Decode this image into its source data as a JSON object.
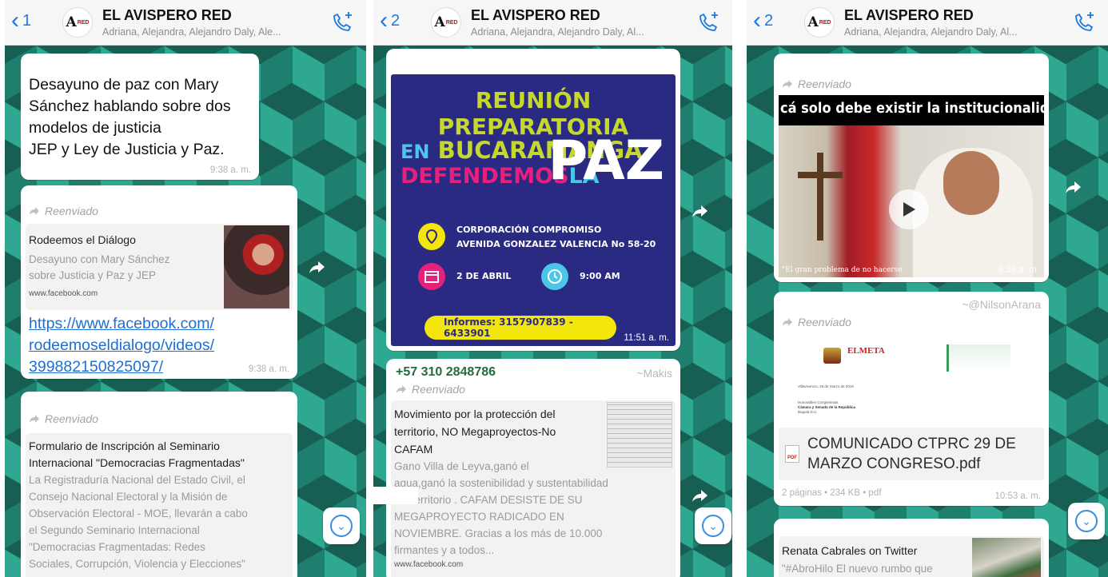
{
  "header": {
    "title": "EL AVISPERO RED",
    "subtitle_1": "Adriana, Alejandra, Alejandro Daly, Ale...",
    "subtitle_2": "Adriana, Alejandra, Alejandro Daly, Al...",
    "avatar_letter": "A",
    "avatar_small": "RED",
    "back_1": "1",
    "back_2": "2",
    "back_3": "2"
  },
  "panel1": {
    "msg1": {
      "lines": [
        "Desayuno de paz con Mary",
        "Sánchez hablando sobre dos",
        "modelos de justicia",
        "JEP y Ley de Justicia y Paz."
      ],
      "time": "9:38 a. m."
    },
    "msg2": {
      "forwarded": "Reenviado",
      "preview_title": "Rodeemos el Diálogo",
      "preview_desc_1": "Desayuno con Mary Sánchez",
      "preview_desc_2": "sobre Justicia y Paz y JEP",
      "preview_url": "www.facebook.com",
      "link_1": "https://www.facebook.com/",
      "link_2": "rodeemoseldialogo/videos/",
      "link_3": "399882150825097/",
      "time": "9:38 a. m."
    },
    "msg3": {
      "forwarded": "Reenviado",
      "title_1": "Formulario de Inscripción al Seminario",
      "title_2": "Internacional \"Democracias Fragmentadas\"",
      "desc": [
        "La Registraduría Nacional del Estado Civil, el",
        "Consejo Nacional Electoral y la Misión de",
        "Observación Electoral - MOE, llevarán a cabo",
        "el Segundo Seminario Internacional",
        "\"Democracias Fragmentadas: Redes",
        "Sociales, Corrupción, Violencia y Elecciones\""
      ]
    }
  },
  "panel2": {
    "poster": {
      "title": "REUNIÓN PREPARATORIA",
      "line_en": "EN",
      "line_city": "BUCARAMANGA",
      "line_def": "DEFENDEMOS",
      "line_la": "LA",
      "line_paz": "PAZ",
      "place_1": "CORPORACIÓN COMPROMISO",
      "place_2": "AVENIDA GONZALEZ VALENCIA No 58-20",
      "date": "2 DE ABRIL",
      "hour": "9:00 AM",
      "info": "Informes:  3157907839 - 6433901",
      "time": "11:51 a. m."
    },
    "msg2": {
      "sender": "+57 310 2848786",
      "sender_alias": "~Makis",
      "forwarded": "Reenviado",
      "title_1": "Movimiento por la protección del",
      "title_2": "territorio, NO Megaproyectos-No",
      "title_3": "CAFAM",
      "desc": [
        "Gano Villa de Leyva,ganó el",
        "agua,ganó la sostenibilidad y sustentabilidad",
        "del territorio . CAFAM DESISTE DE SU",
        "MEGAPROYECTO RADICADO EN",
        "NOVIEMBRE. Gracias a los más de 10.000",
        "firmantes y a todos..."
      ],
      "url": "www.facebook.com"
    }
  },
  "panel3": {
    "video": {
      "forwarded": "Reenviado",
      "banner": "cá solo debe existir la institucionalida",
      "caption": "\"El gran problema de no hacerse",
      "time": "8:36 a. m."
    },
    "doc": {
      "sender_alias": "~@NilsonArana",
      "forwarded": "Reenviado",
      "logo_text": "ELMETA",
      "doc_line_1": "Villavicencio, 29 de marzo de 2019",
      "doc_line_2": "Honorables Congresistas",
      "doc_line_3": "Cámara y Senado de la República",
      "doc_line_4": "Bogotá D.C.",
      "file_name_1": "COMUNICADO CTPRC 29 DE",
      "file_name_2": "MARZO CONGRESO.pdf",
      "file_meta": "2 páginas • 234 KB • pdf",
      "time": "10:53 a. m."
    },
    "tw": {
      "title": "Renata Cabrales on Twitter",
      "desc": "\"#AbroHilo El nuevo rumbo que"
    }
  }
}
